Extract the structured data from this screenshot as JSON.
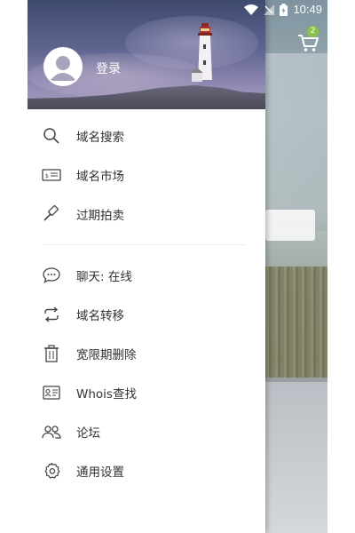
{
  "status_bar": {
    "time": "10:49"
  },
  "header": {
    "login_label": "登录"
  },
  "cart": {
    "badge_count": "2"
  },
  "menu_group_1": [
    {
      "label": "域名搜索",
      "icon": "search-icon"
    },
    {
      "label": "域名市场",
      "icon": "ticket-icon"
    },
    {
      "label": "过期拍卖",
      "icon": "gavel-icon"
    }
  ],
  "menu_group_2": [
    {
      "label": "聊天: 在线",
      "icon": "chat-icon"
    },
    {
      "label": "域名转移",
      "icon": "transfer-icon"
    },
    {
      "label": "宽限期删除",
      "icon": "trash-icon"
    },
    {
      "label": "Whois查找",
      "icon": "id-card-icon"
    },
    {
      "label": "论坛",
      "icon": "users-icon"
    },
    {
      "label": "通用设置",
      "icon": "gear-icon"
    }
  ],
  "colors": {
    "drawer_bg": "#ffffff",
    "text": "#333333",
    "header_gradient_top": "#3f4a6e",
    "badge": "#8bc34a"
  }
}
